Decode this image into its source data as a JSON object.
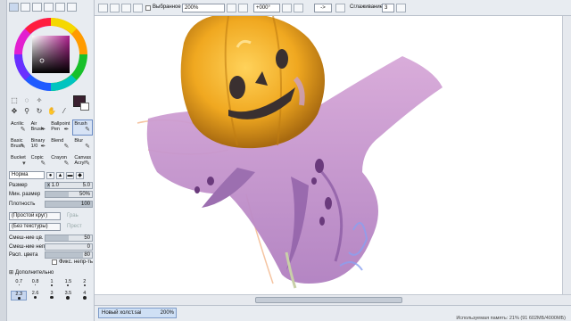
{
  "toolbar": {
    "selection_label": "Выбранное",
    "zoom": "200%",
    "angle": "+000°",
    "flip_label": "->",
    "smoothing_label": "Сглаживание",
    "smoothing_value": "3"
  },
  "colors": {
    "foreground": "#3a2030",
    "background": "#ffffff"
  },
  "brushes": [
    {
      "label": "Acrilic",
      "icon": "✎"
    },
    {
      "label": "Air Brush",
      "icon": "✒"
    },
    {
      "label": "Ballpoint Pen",
      "icon": "✒"
    },
    {
      "label": "Brush",
      "icon": "✎"
    },
    {
      "label": "Basic Brush",
      "icon": "✎"
    },
    {
      "label": "Binary 1/0",
      "icon": "✒"
    },
    {
      "label": "Blend",
      "icon": "✎"
    },
    {
      "label": "Blur",
      "icon": "✎"
    },
    {
      "label": "Bucket",
      "icon": "▾"
    },
    {
      "label": "Copic",
      "icon": "✎"
    },
    {
      "label": "Crayon",
      "icon": "✎"
    },
    {
      "label": "Canvas Acryl",
      "icon": "✎"
    }
  ],
  "blend_mode": "Норма",
  "properties": {
    "size": {
      "label": "Размер",
      "multiplier": "x 1.0",
      "value": "5.0",
      "fill": 0.1
    },
    "min_size": {
      "label": "Мин. размер",
      "value": "50%",
      "fill": 0.5
    },
    "density": {
      "label": "Плотность",
      "value": "100",
      "fill": 1.0
    },
    "mix_color": {
      "label": "Смеш-ние цв.",
      "value": "50",
      "fill": 0.5
    },
    "mix_opacity": {
      "label": "Смеш-ние непр.",
      "value": "0",
      "fill": 0.0
    },
    "stretch_color": {
      "label": "Расп. цвета",
      "value": "80",
      "fill": 0.8
    }
  },
  "shape_dropdown": {
    "value": "(Простой круг)",
    "extra": "Граь"
  },
  "texture_dropdown": {
    "value": "(Без текстуры)",
    "extra": "Прест"
  },
  "keep_opacity_label": "Фикс. непр-ть",
  "advanced_label": "Дополнительно",
  "sizes": [
    "0.7",
    "0.8",
    "1",
    "1.5",
    "2",
    "2.3",
    "2.6",
    "3",
    "3.5",
    "4"
  ],
  "selected_size_index": 5,
  "document": {
    "name": "Новый холст.sai",
    "zoom": "200%"
  },
  "status": "Используемая память: 21% (91 602МБ/4000МБ)"
}
